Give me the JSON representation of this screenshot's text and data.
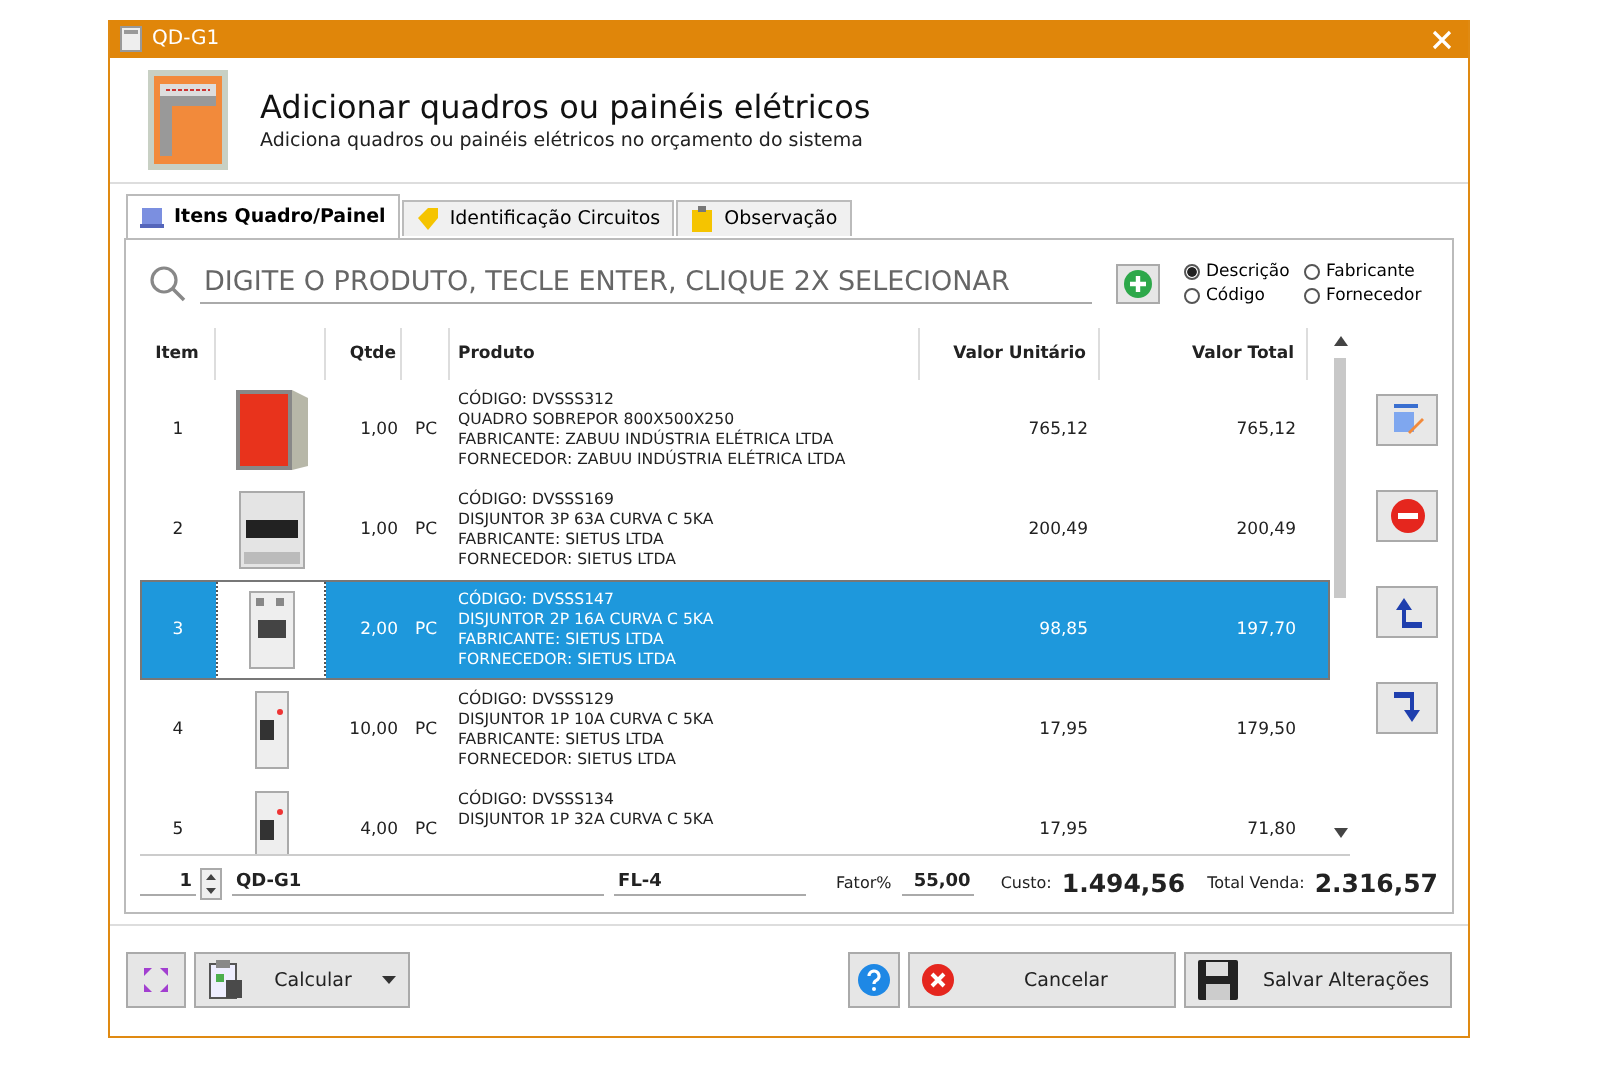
{
  "window": {
    "title": "QD-G1"
  },
  "header": {
    "title": "Adicionar quadros ou painéis elétricos",
    "subtitle": "Adiciona quadros ou painéis elétricos no orçamento do sistema"
  },
  "tabs": [
    {
      "label": "Itens Quadro/Painel",
      "selected": true,
      "kind": "list"
    },
    {
      "label": "Identificação Circuitos",
      "selected": false,
      "kind": "tag"
    },
    {
      "label": "Observação",
      "selected": false,
      "kind": "note"
    }
  ],
  "search": {
    "placeholder": "DIGITE O PRODUTO, TECLE ENTER, CLIQUE 2X SELECIONAR"
  },
  "search_options": [
    {
      "label": "Descrição",
      "selected": true
    },
    {
      "label": "Fabricante",
      "selected": false
    },
    {
      "label": "Código",
      "selected": false
    },
    {
      "label": "Fornecedor",
      "selected": false
    }
  ],
  "table": {
    "columns": [
      "Item",
      "Qtde",
      "Produto",
      "Valor Unitário",
      "Valor Total"
    ],
    "rows": [
      {
        "item": "1",
        "kind": "cabinet",
        "qty": "1,00",
        "unit": "PC",
        "product": [
          "CÓDIGO: DVSSS312",
          "QUADRO SOBREPOR 800X500X250",
          "FABRICANTE: ZABUU INDÚSTRIA ELÉTRICA LTDA",
          "FORNECEDOR: ZABUU INDÚSTRIA ELÉTRICA LTDA"
        ],
        "unit_price": "765,12",
        "total": "765,12",
        "selected": false
      },
      {
        "item": "2",
        "kind": "breaker3",
        "qty": "1,00",
        "unit": "PC",
        "product": [
          "CÓDIGO: DVSSS169",
          "DISJUNTOR 3P 63A CURVA C 5KA",
          "FABRICANTE: SIETUS LTDA",
          "FORNECEDOR: SIETUS LTDA"
        ],
        "unit_price": "200,49",
        "total": "200,49",
        "selected": false
      },
      {
        "item": "3",
        "kind": "breaker2",
        "qty": "2,00",
        "unit": "PC",
        "product": [
          "CÓDIGO: DVSSS147",
          "DISJUNTOR 2P 16A CURVA C 5KA",
          "FABRICANTE: SIETUS LTDA",
          "FORNECEDOR: SIETUS LTDA"
        ],
        "unit_price": "98,85",
        "total": "197,70",
        "selected": true
      },
      {
        "item": "4",
        "kind": "breaker1",
        "qty": "10,00",
        "unit": "PC",
        "product": [
          "CÓDIGO: DVSSS129",
          "DISJUNTOR 1P 10A CURVA C 5KA",
          "FABRICANTE: SIETUS LTDA",
          "FORNECEDOR: SIETUS LTDA"
        ],
        "unit_price": "17,95",
        "total": "179,50",
        "selected": false
      },
      {
        "item": "5",
        "kind": "breaker1",
        "qty": "4,00",
        "unit": "PC",
        "product": [
          "CÓDIGO: DVSSS134",
          "DISJUNTOR 1P 32A CURVA C 5KA"
        ],
        "unit_price": "17,95",
        "total": "71,80",
        "selected": false
      }
    ]
  },
  "footer": {
    "quantity": "1",
    "panel_name": "QD-G1",
    "panel_code": "FL-4",
    "factor_label": "Fator%",
    "factor": "55,00",
    "cost_label": "Custo:",
    "cost": "1.494,56",
    "sale_label": "Total Venda:",
    "sale": "2.316,57"
  },
  "buttons": {
    "calculate": "Calcular",
    "cancel": "Cancelar",
    "save": "Salvar Alterações"
  }
}
